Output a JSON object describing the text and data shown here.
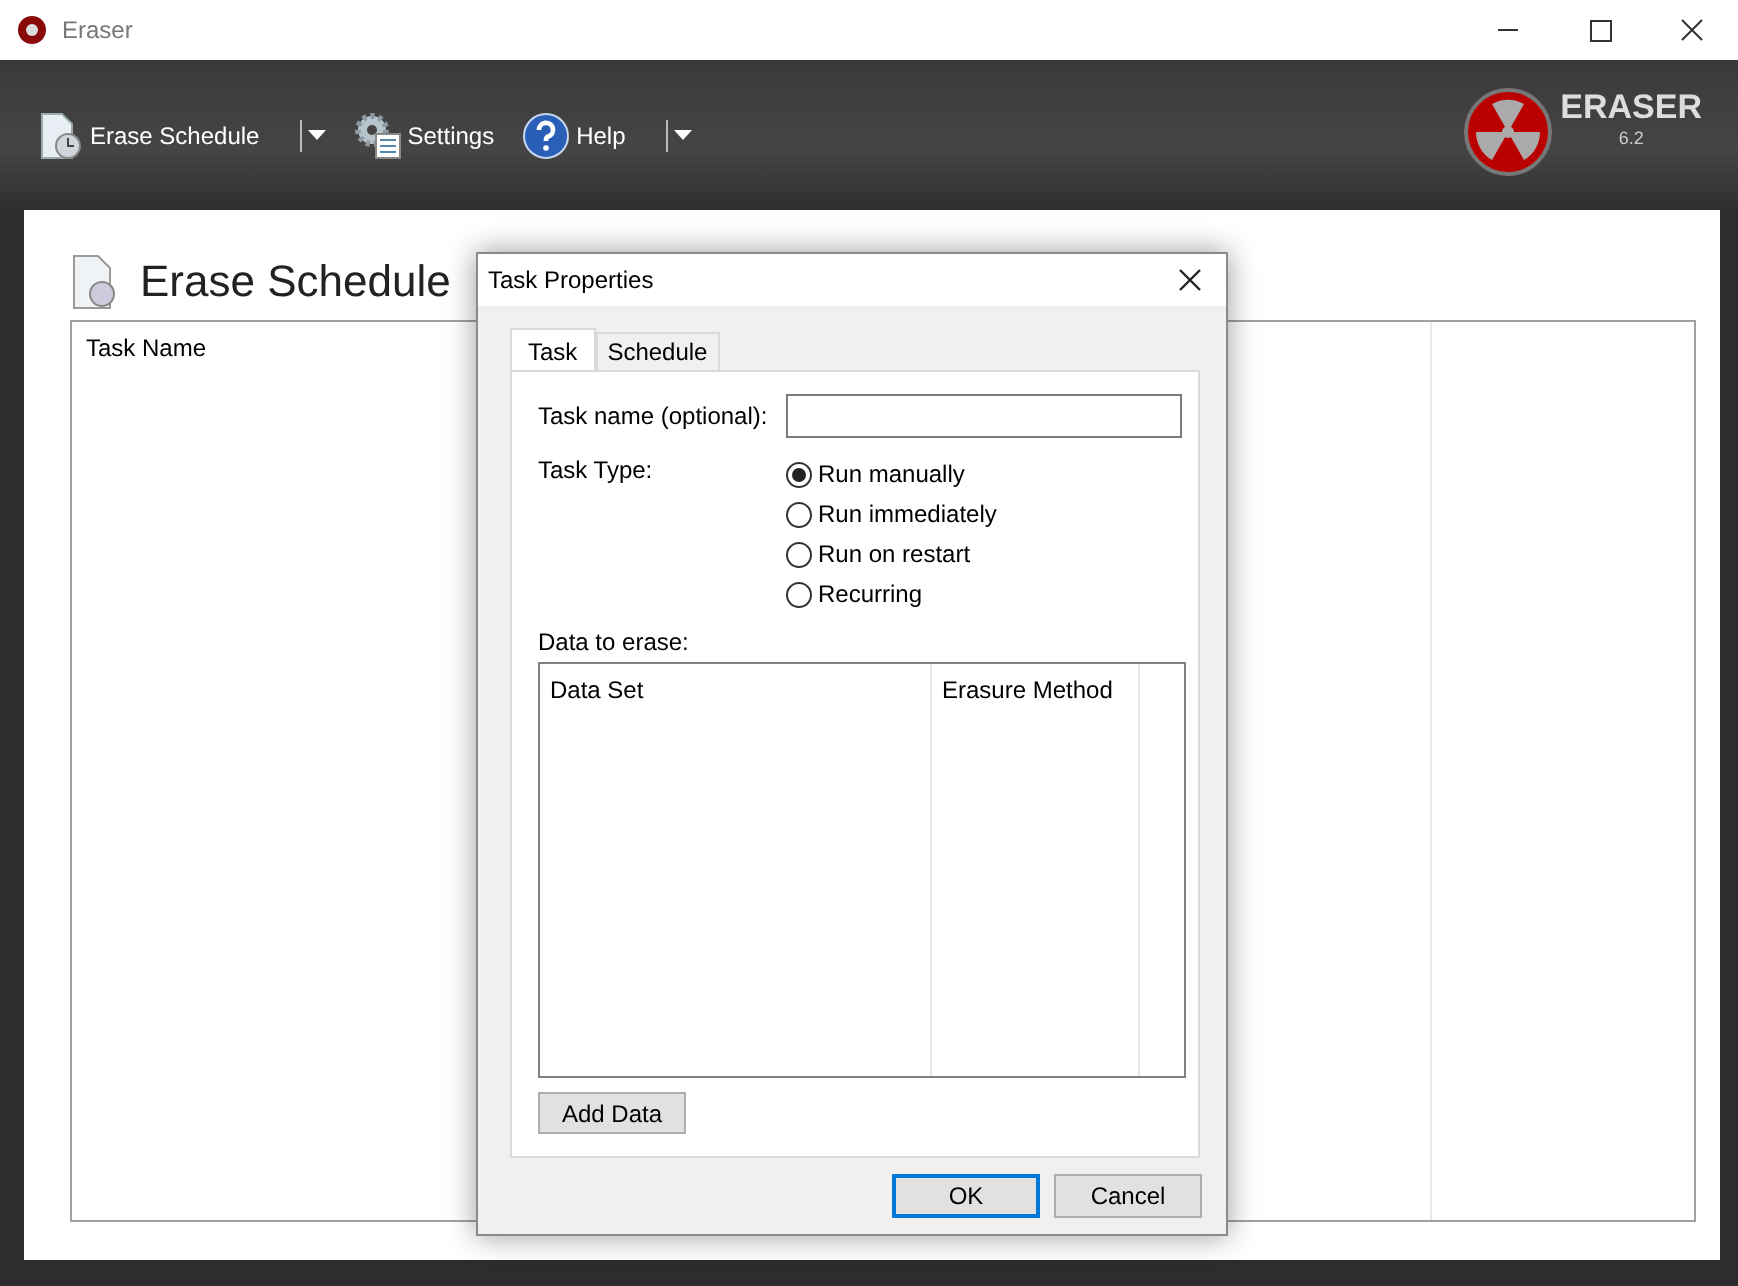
{
  "window": {
    "title": "Eraser"
  },
  "toolbar": [
    {
      "label": "Erase Schedule",
      "kind": "schedule",
      "has_dropdown": true
    },
    {
      "label": "Settings",
      "kind": "settings",
      "has_dropdown": false
    },
    {
      "label": "Help",
      "kind": "help",
      "has_dropdown": true
    }
  ],
  "logo": {
    "name": "ERASER",
    "version": "6.2"
  },
  "page": {
    "title": "Erase Schedule",
    "table": {
      "columns": [
        "Task Name"
      ]
    }
  },
  "dialog": {
    "title": "Task Properties",
    "tabs": [
      {
        "label": "Task",
        "selected": true
      },
      {
        "label": "Schedule",
        "selected": false
      }
    ],
    "task_name": {
      "label": "Task name (optional):"
    },
    "task_type": {
      "label": "Task Type:",
      "options": [
        {
          "label": "Run manually",
          "selected": true
        },
        {
          "label": "Run immediately",
          "selected": false
        },
        {
          "label": "Run on restart",
          "selected": false
        },
        {
          "label": "Recurring",
          "selected": false
        }
      ]
    },
    "data_to_erase": {
      "label": "Data to erase:",
      "columns": [
        "Data Set",
        "Erasure Method"
      ]
    },
    "add_button": "Add Data",
    "buttons": [
      {
        "label": "OK",
        "default": true
      },
      {
        "label": "Cancel",
        "default": false
      }
    ]
  }
}
